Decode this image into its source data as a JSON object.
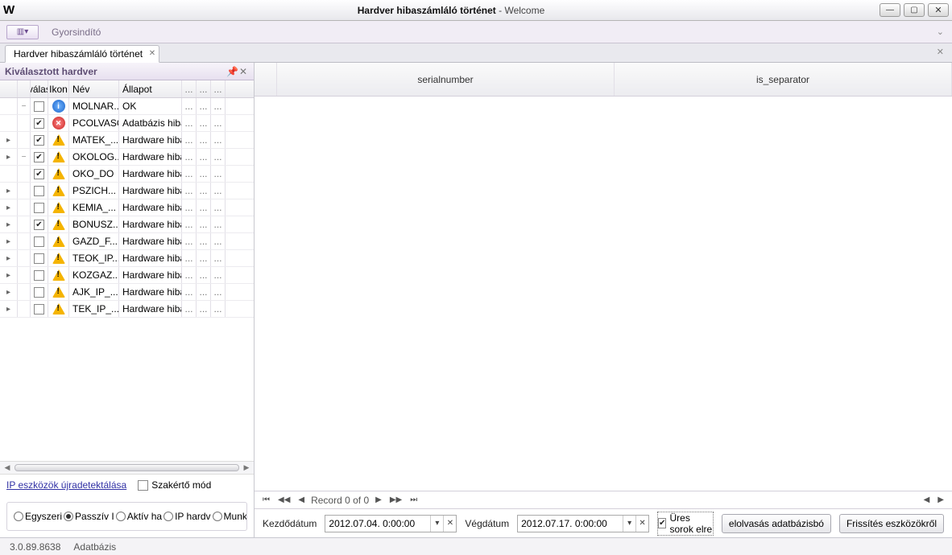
{
  "window": {
    "title_main": "Hardver hibaszámláló történet",
    "title_sub": " - Welcome",
    "app_glyph": "W"
  },
  "ribbon": {
    "launch": "Gyorsindító"
  },
  "tab": {
    "label": "Hardver hibaszámláló történet"
  },
  "panel": {
    "title": "Kiválasztott hardver"
  },
  "grid": {
    "headers": {
      "sel": "Kiválas...",
      "icon": "Ikon",
      "name": "Név",
      "status": "Állapot",
      "dots": "..."
    },
    "rows": [
      {
        "ind": "",
        "exp": "−",
        "checked": false,
        "icon": "info",
        "name": "MOLNAR...",
        "status": "OK"
      },
      {
        "ind": "",
        "exp": "",
        "checked": true,
        "icon": "err",
        "name": "PCOLVASO",
        "status": "Adatbázis hiba"
      },
      {
        "ind": "▸",
        "exp": "",
        "checked": true,
        "icon": "warn",
        "name": "MATEK_...",
        "status": "Hardware hiba"
      },
      {
        "ind": "▸",
        "exp": "−",
        "checked": true,
        "icon": "warn",
        "name": "OKOLOG...",
        "status": "Hardware hiba"
      },
      {
        "ind": "",
        "exp": "",
        "checked": true,
        "icon": "warn",
        "name": "OKO_DO",
        "status": "Hardware hiba"
      },
      {
        "ind": "▸",
        "exp": "",
        "checked": false,
        "icon": "warn",
        "name": "PSZICH...",
        "status": "Hardware hiba"
      },
      {
        "ind": "▸",
        "exp": "",
        "checked": false,
        "icon": "warn",
        "name": "KEMIA_...",
        "status": "Hardware hiba"
      },
      {
        "ind": "▸",
        "exp": "",
        "checked": true,
        "icon": "warn",
        "name": "BONUSZ...",
        "status": "Hardware hiba"
      },
      {
        "ind": "▸",
        "exp": "",
        "checked": false,
        "icon": "warn",
        "name": "GAZD_F...",
        "status": "Hardware hiba"
      },
      {
        "ind": "▸",
        "exp": "",
        "checked": false,
        "icon": "warn",
        "name": "TEOK_IP...",
        "status": "Hardware hiba"
      },
      {
        "ind": "▸",
        "exp": "",
        "checked": false,
        "icon": "warn",
        "name": "KOZGAZ...",
        "status": "Hardware hiba"
      },
      {
        "ind": "▸",
        "exp": "",
        "checked": false,
        "icon": "warn",
        "name": "AJK_IP_...",
        "status": "Hardware hiba"
      },
      {
        "ind": "▸",
        "exp": "",
        "checked": false,
        "icon": "warn",
        "name": "TEK_IP_...",
        "status": "Hardware hiba"
      }
    ]
  },
  "left_tools": {
    "redetect": "IP eszközök újradetektálása",
    "expert": "Szakértő mód"
  },
  "radios": {
    "items": [
      "Egyszeri",
      "Passzív I",
      "Aktív ha",
      "IP hardv",
      "Munkaál"
    ],
    "selected": 1
  },
  "right_headers": {
    "a": "serialnumber",
    "b": "is_separator"
  },
  "pager": {
    "text": "Record 0 of 0"
  },
  "bottom": {
    "start_lbl": "Kezdődátum",
    "start_val": "2012.07.04. 0:00:00",
    "end_lbl": "Végdátum",
    "end_val": "2012.07.17. 0:00:00",
    "hide_empty": "Üres sorok elre",
    "btn_reload": "elolvasás adatbázisbó",
    "btn_refresh": "Frissítés eszközökről"
  },
  "status": {
    "ver": "3.0.89.8638",
    "db": "Adatbázis"
  }
}
